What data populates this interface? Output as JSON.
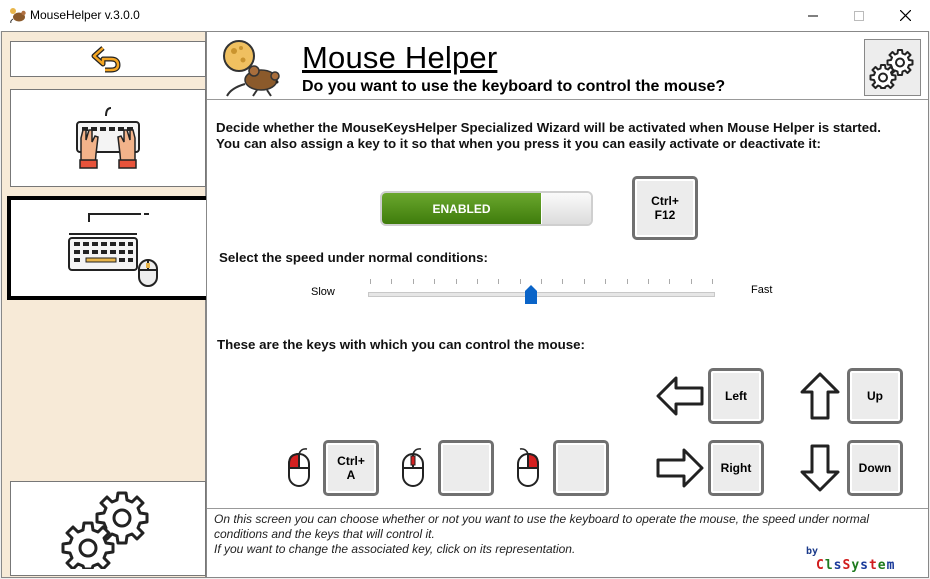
{
  "window": {
    "title": "MouseHelper v.3.0.0",
    "minimize_icon": "minimize-icon",
    "maximize_icon": "maximize-icon",
    "close_icon": "close-icon"
  },
  "sidebar": {
    "items": [
      {
        "name": "back",
        "icon": "undo-arrow-icon",
        "color": "#f5a623"
      },
      {
        "name": "keyboard",
        "icon": "hands-on-keyboard-icon"
      },
      {
        "name": "mouse-keys",
        "icon": "keyboard-mouse-icon",
        "selected": true
      },
      {
        "name": "settings",
        "icon": "gears-icon"
      }
    ]
  },
  "header": {
    "title": "Mouse Helper",
    "subtitle": "Do you want to use the keyboard to control the mouse?",
    "logo_icon": "mouse-cheese-icon",
    "settings_icon": "gears-icon"
  },
  "content": {
    "description_line1": "Decide whether the MouseKeysHelper Specialized Wizard will be activated when Mouse Helper is started.",
    "description_line2": "You can also assign a key to it so that when you press it you can easily activate or deactivate it:",
    "toggle": {
      "label": "ENABLED",
      "state": true,
      "color": "#4f8f1a"
    },
    "hotkey": {
      "line1": "Ctrl+",
      "line2": "F12"
    },
    "speed": {
      "label": "Select the speed under normal conditions:",
      "min_label": "Slow",
      "max_label": "Fast",
      "value": 0.47
    },
    "keys_label": "These are the keys with which you can control the mouse:",
    "buttons": {
      "left_click": {
        "line1": "Ctrl+",
        "line2": "A",
        "icon": "mouse-left-button-icon"
      },
      "middle_click": {
        "line1": "",
        "line2": "",
        "icon": "mouse-middle-button-icon"
      },
      "right_click": {
        "line1": "",
        "line2": "",
        "icon": "mouse-right-button-icon"
      }
    },
    "directions": {
      "left": {
        "label": "Left",
        "icon": "arrow-left-icon"
      },
      "up": {
        "label": "Up",
        "icon": "arrow-up-icon"
      },
      "right": {
        "label": "Right",
        "icon": "arrow-right-icon"
      },
      "down": {
        "label": "Down",
        "icon": "arrow-down-icon"
      }
    }
  },
  "footer": {
    "text_line1": "On this screen you can choose whether or not you want to use the keyboard to operate the mouse, the speed under normal conditions and the keys that will control it.",
    "text_line2": "If you want to change the associated key, click on its representation.",
    "by": "by",
    "brand_chars": [
      "C",
      "l",
      "s",
      "S",
      "y",
      "s",
      "t",
      "e",
      "m"
    ],
    "brand_colors": [
      "#d01c1c",
      "#1d7a1d",
      "#1a3a9a",
      "#d01c1c",
      "#1d7a1d",
      "#1a3a9a",
      "#d01c1c",
      "#1d7a1d",
      "#1a3a9a"
    ]
  }
}
